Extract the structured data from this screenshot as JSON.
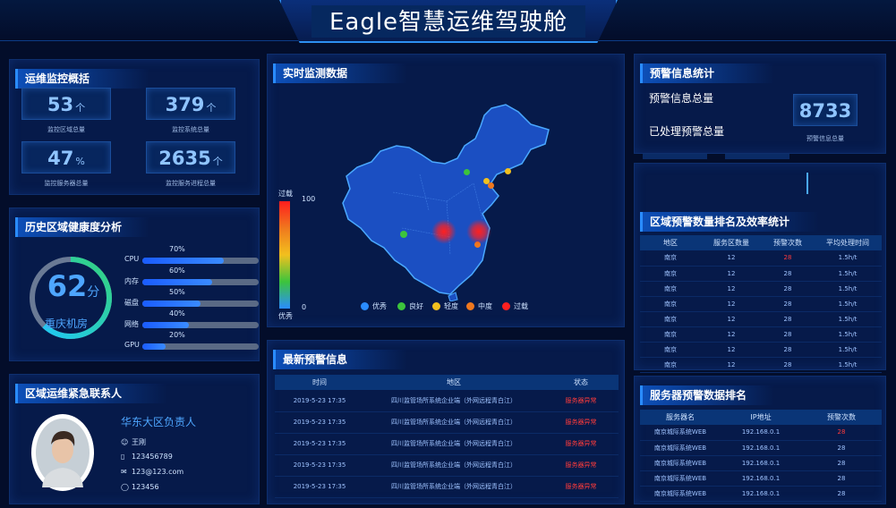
{
  "header": {
    "title": "Eagle智慧运维驾驶舱"
  },
  "overview": {
    "title": "运维监控概括",
    "stats": [
      {
        "value": "53",
        "unit": "个",
        "label": "监控区域总量"
      },
      {
        "value": "379",
        "unit": "个",
        "label": "监控系统总量"
      },
      {
        "value": "47",
        "unit": "%",
        "label": "监控服务器总量"
      },
      {
        "value": "2635",
        "unit": "个",
        "label": "监控服务进程总量"
      }
    ]
  },
  "health": {
    "title": "历史区域健康度分析",
    "gauge_value": "62",
    "gauge_unit": "分",
    "gauge_fraction": 0.62,
    "gauge_label": "重庆机房",
    "bars": [
      {
        "label": "CPU",
        "percent": "70%",
        "value": 0.7
      },
      {
        "label": "内存",
        "percent": "60%",
        "value": 0.6
      },
      {
        "label": "磁盘",
        "percent": "50%",
        "value": 0.5
      },
      {
        "label": "网络",
        "percent": "40%",
        "value": 0.4
      },
      {
        "label": "GPU",
        "percent": "20%",
        "value": 0.2
      }
    ]
  },
  "contact": {
    "title": "区域运维紧急联系人",
    "role": "华东大区负责人",
    "name": "王刚",
    "phone": "123456789",
    "email": "123@123.com",
    "qq": "123456"
  },
  "monitor": {
    "title": "实时监测数据",
    "scale_top_label": "过载",
    "scale_top_value": "100",
    "scale_bottom_label": "优秀",
    "scale_bottom_value": "0",
    "legend": [
      {
        "label": "优秀",
        "color": "#2a8cff"
      },
      {
        "label": "良好",
        "color": "#3cc43c"
      },
      {
        "label": "轻度",
        "color": "#f2c01e"
      },
      {
        "label": "中度",
        "color": "#f0781e"
      },
      {
        "label": "过载",
        "color": "#ff2020"
      }
    ]
  },
  "alerts_latest": {
    "title": "最新预警信息",
    "columns": [
      "时间",
      "地区",
      "状态"
    ],
    "rows": [
      [
        "2019-5-23 17:35",
        "四川监管场所系统企业端（外网远程青白江）",
        "服务器异常"
      ],
      [
        "2019-5-23 17:35",
        "四川监管场所系统企业端（外网远程青白江）",
        "服务器异常"
      ],
      [
        "2019-5-23 17:35",
        "四川监管场所系统企业端（外网远程青白江）",
        "服务器异常"
      ],
      [
        "2019-5-23 17:35",
        "四川监管场所系统企业端（外网远程青白江）",
        "服务器异常"
      ],
      [
        "2019-5-23 17:35",
        "四川监管场所系统企业端（外网远程青白江）",
        "服务器异常"
      ]
    ]
  },
  "warning_stats": {
    "title": "预警信息统计",
    "total_label": "预警信息总量",
    "processed_label": "已处理预警总量",
    "total_value": "8733",
    "total_caption": "预警信息总量"
  },
  "region_rank": {
    "title": "区域预警数量排名及效率统计",
    "columns": [
      "地区",
      "服务区数量",
      "预警次数",
      "平均处理时间"
    ],
    "rows": [
      [
        "南京",
        "12",
        "28",
        "1.5h/t"
      ],
      [
        "南京",
        "12",
        "28",
        "1.5h/t"
      ],
      [
        "南京",
        "12",
        "28",
        "1.5h/t"
      ],
      [
        "南京",
        "12",
        "28",
        "1.5h/t"
      ],
      [
        "南京",
        "12",
        "28",
        "1.5h/t"
      ],
      [
        "南京",
        "12",
        "28",
        "1.5h/t"
      ],
      [
        "南京",
        "12",
        "28",
        "1.5h/t"
      ],
      [
        "南京",
        "12",
        "28",
        "1.5h/t"
      ]
    ]
  },
  "server_rank": {
    "title": "服务器预警数据排名",
    "columns": [
      "服务器名",
      "IP地址",
      "预警次数"
    ],
    "rows": [
      [
        "南京城际系统WEB",
        "192.168.0.1",
        "28"
      ],
      [
        "南京城际系统WEB",
        "192.168.0.1",
        "28"
      ],
      [
        "南京城际系统WEB",
        "192.168.0.1",
        "28"
      ],
      [
        "南京城际系统WEB",
        "192.168.0.1",
        "28"
      ],
      [
        "南京城际系统WEB",
        "192.168.0.1",
        "28"
      ]
    ]
  }
}
